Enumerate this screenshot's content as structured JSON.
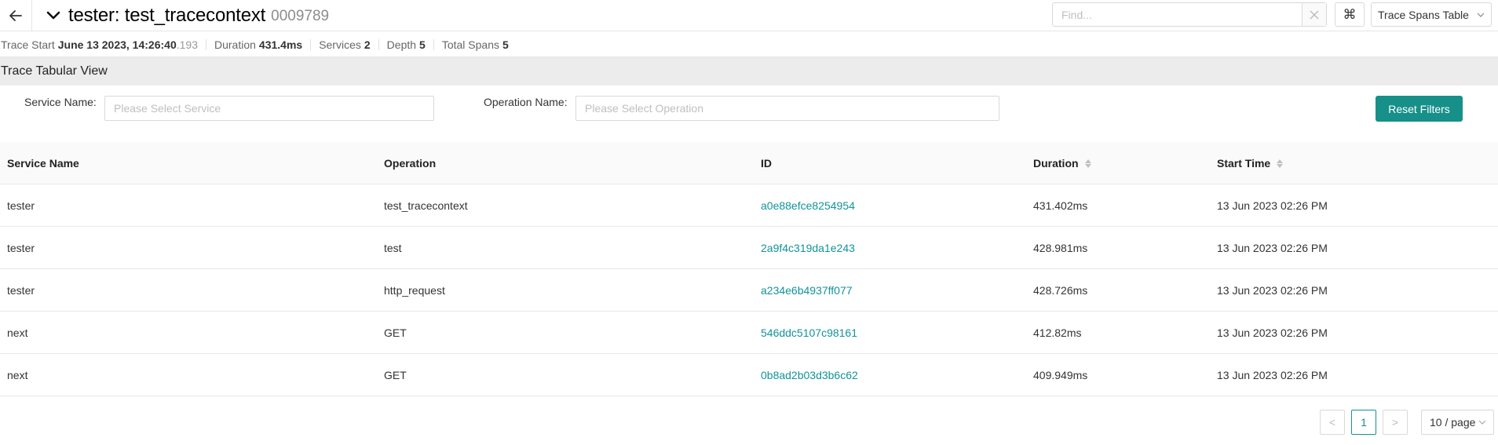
{
  "header": {
    "title": "tester: test_tracecontext",
    "trace_id": "0009789",
    "find_placeholder": "Find...",
    "cmd_symbol": "⌘",
    "view_select": "Trace Spans Table"
  },
  "summary": {
    "trace_start_label": "Trace Start",
    "trace_start_value": "June 13 2023, 14:26:40",
    "trace_start_ms": ".193",
    "duration_label": "Duration",
    "duration_value": "431.4ms",
    "services_label": "Services",
    "services_value": "2",
    "depth_label": "Depth",
    "depth_value": "5",
    "total_spans_label": "Total Spans",
    "total_spans_value": "5"
  },
  "section": {
    "title": "Trace Tabular View"
  },
  "filters": {
    "service_label": "Service Name",
    "service_placeholder": "Please Select Service",
    "operation_label": "Operation Name",
    "operation_placeholder": "Please Select Operation",
    "reset_label": "Reset Filters"
  },
  "table": {
    "columns": [
      "Service Name",
      "Operation",
      "ID",
      "Duration",
      "Start Time"
    ],
    "rows": [
      {
        "service": "tester",
        "operation": "test_tracecontext",
        "id": "a0e88efce8254954",
        "duration": "431.402ms",
        "start": "13 Jun 2023 02:26 PM"
      },
      {
        "service": "tester",
        "operation": "test",
        "id": "2a9f4c319da1e243",
        "duration": "428.981ms",
        "start": "13 Jun 2023 02:26 PM"
      },
      {
        "service": "tester",
        "operation": "http_request",
        "id": "a234e6b4937ff077",
        "duration": "428.726ms",
        "start": "13 Jun 2023 02:26 PM"
      },
      {
        "service": "next",
        "operation": "GET",
        "id": "546ddc5107c98161",
        "duration": "412.82ms",
        "start": "13 Jun 2023 02:26 PM"
      },
      {
        "service": "next",
        "operation": "GET",
        "id": "0b8ad2b03d3b6c62",
        "duration": "409.949ms",
        "start": "13 Jun 2023 02:26 PM"
      }
    ]
  },
  "pagination": {
    "prev": "<",
    "current_page": "1",
    "next": ">",
    "page_size": "10 / page"
  },
  "colors": {
    "accent": "#169089",
    "link": "#11939a"
  }
}
